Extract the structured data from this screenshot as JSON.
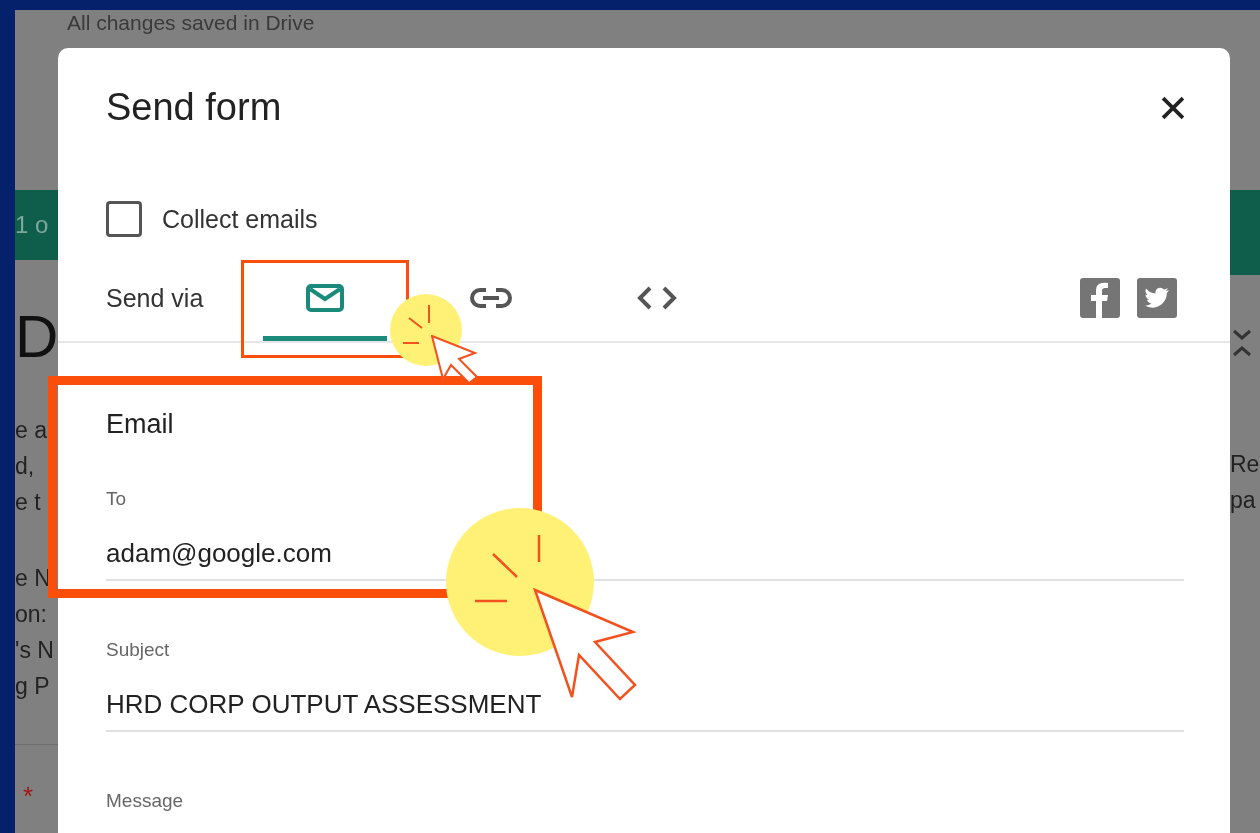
{
  "background_page": {
    "save_status": "All changes saved in Drive",
    "left_tab_text": "1 o",
    "title_fragment": "D",
    "left_text_lines": [
      "e a",
      "d,",
      "e t"
    ],
    "left_text_lines_2": [
      "e N",
      "on:",
      "'s N",
      "g P"
    ],
    "required_mark": "*",
    "right_text_lines": [
      "Re",
      "pa"
    ]
  },
  "dialog": {
    "title": "Send form",
    "collect_emails": {
      "label": "Collect emails",
      "checked": false
    },
    "send_via": {
      "label": "Send via",
      "tabs": [
        {
          "kind": "email",
          "selected": true
        },
        {
          "kind": "link",
          "selected": false
        },
        {
          "kind": "embed",
          "selected": false
        }
      ]
    },
    "share": [
      {
        "kind": "facebook"
      },
      {
        "kind": "twitter"
      }
    ],
    "email": {
      "heading": "Email",
      "fields": [
        {
          "label": "To",
          "value": "adam@google.com"
        },
        {
          "label": "Subject",
          "value": "HRD CORP OUTPUT ASSESSMENT"
        },
        {
          "label": "Message"
        }
      ]
    }
  }
}
